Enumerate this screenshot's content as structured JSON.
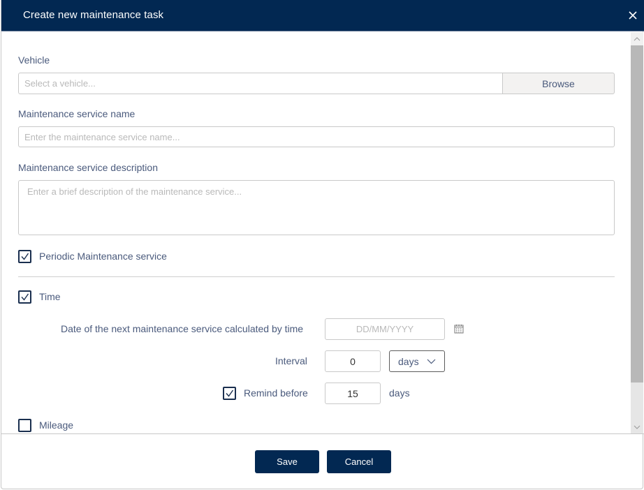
{
  "dialog": {
    "title": "Create new maintenance task",
    "close_icon": "close-icon"
  },
  "vehicle": {
    "label": "Vehicle",
    "placeholder": "Select a vehicle...",
    "value": "",
    "browse_label": "Browse"
  },
  "service_name": {
    "label": "Maintenance service name",
    "placeholder": "Enter the maintenance service name...",
    "value": ""
  },
  "service_description": {
    "label": "Maintenance service description",
    "placeholder": "Enter a brief description of the maintenance service...",
    "value": ""
  },
  "periodic": {
    "label": "Periodic Maintenance service",
    "checked": true
  },
  "time": {
    "label": "Time",
    "checked": true,
    "next_date": {
      "label": "Date of the next maintenance service calculated by time",
      "placeholder": "DD/MM/YYYY",
      "value": "",
      "icon": "calendar-icon"
    },
    "interval": {
      "label": "Interval",
      "value": "0",
      "unit_selected": "days"
    },
    "remind_before": {
      "label": "Remind before",
      "checked": true,
      "value": "15",
      "unit": "days"
    }
  },
  "mileage": {
    "label": "Mileage",
    "checked": false
  },
  "footer": {
    "save_label": "Save",
    "cancel_label": "Cancel"
  },
  "colors": {
    "header_bg": "#022852",
    "primary_button": "#022852",
    "label_text": "#4a5a7c",
    "placeholder_text": "#b9b9b9"
  }
}
